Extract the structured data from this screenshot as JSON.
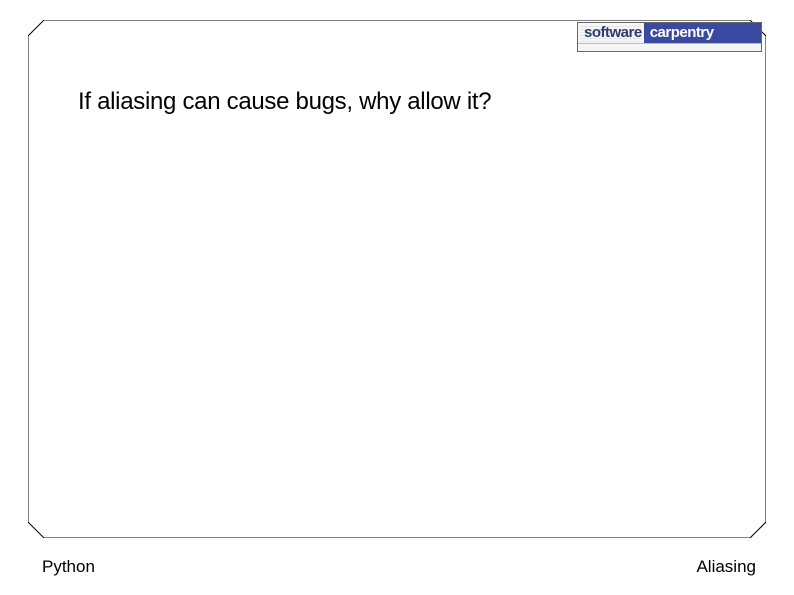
{
  "logo": {
    "left_word": "software",
    "right_word": "carpentry"
  },
  "body": {
    "question": "If aliasing can cause bugs, why allow it?"
  },
  "footer": {
    "left": "Python",
    "right": "Aliasing"
  }
}
